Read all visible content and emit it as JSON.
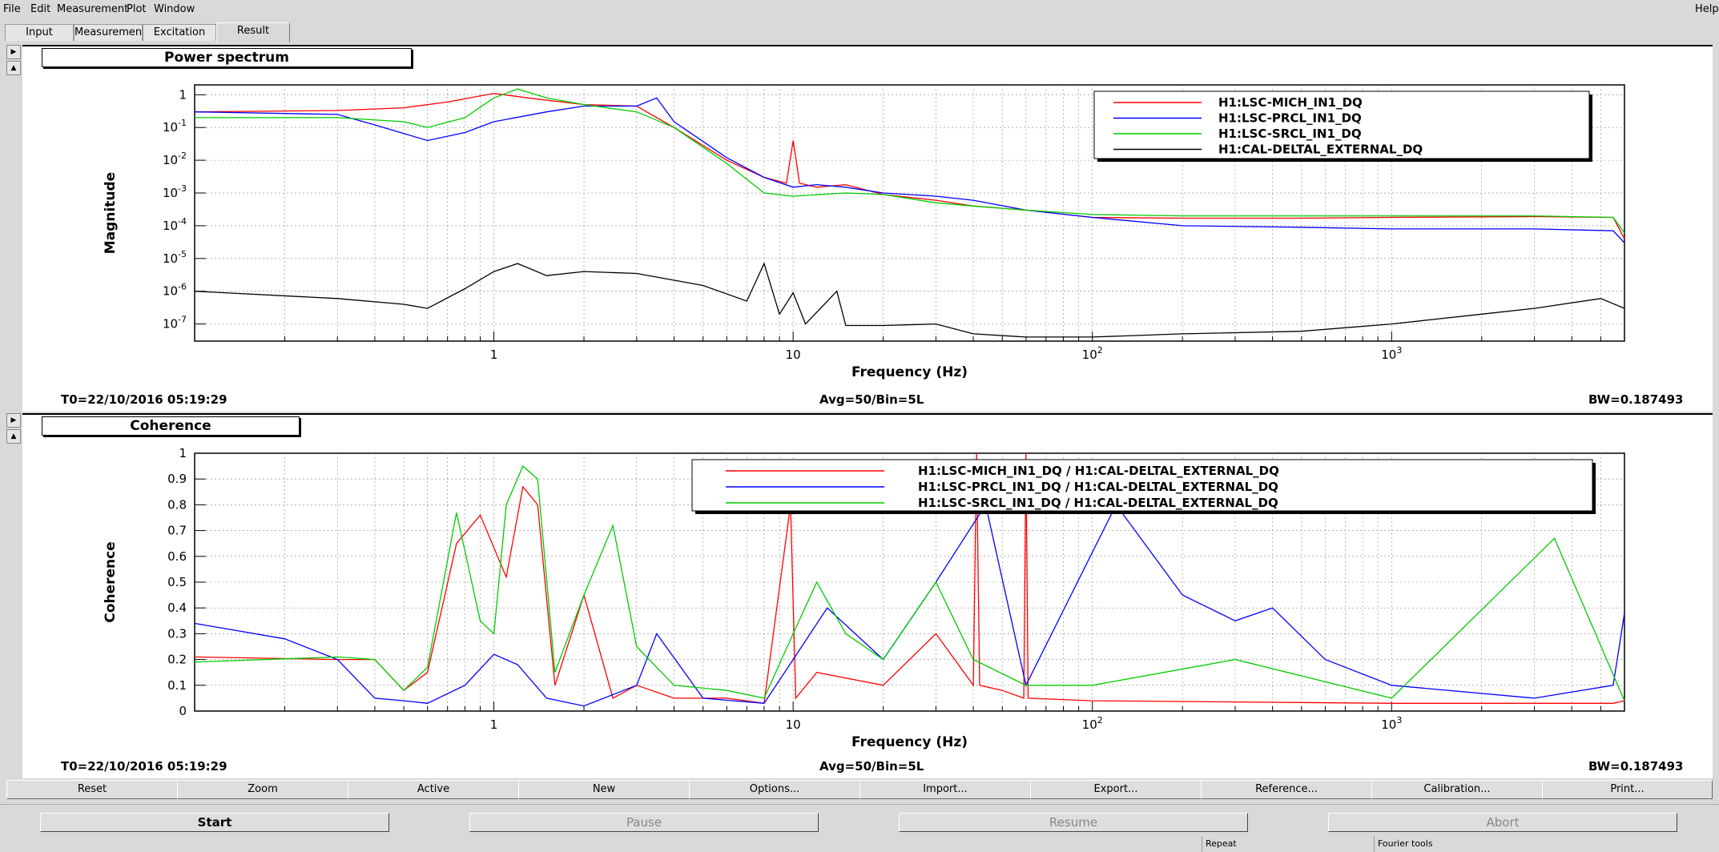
{
  "menubar": {
    "items": [
      "File",
      "Edit",
      "Measurement",
      "Plot",
      "Window"
    ],
    "help": "Help"
  },
  "tabs": [
    "Input",
    "Measurement",
    "Excitation",
    "Result"
  ],
  "active_tab": "Result",
  "colors": {
    "mich": "#ff0000",
    "prcl": "#0000ff",
    "srcl": "#00cc00",
    "darm": "#000000"
  },
  "power_panel": {
    "title": "Power spectrum",
    "ylabel": "Magnitude",
    "xlabel": "Frequency (Hz)",
    "t0": "T0=22/10/2016 05:19:29",
    "avg": "Avg=50/Bin=5L",
    "bw": "BW=0.187493",
    "legend": [
      "H1:LSC-MICH_IN1_DQ",
      "H1:LSC-PRCL_IN1_DQ",
      "H1:LSC-SRCL_IN1_DQ",
      "H1:CAL-DELTAL_EXTERNAL_DQ"
    ]
  },
  "coh_panel": {
    "title": "Coherence",
    "ylabel": "Coherence",
    "xlabel": "Frequency (Hz)",
    "t0": "T0=22/10/2016 05:19:29",
    "avg": "Avg=50/Bin=5L",
    "bw": "BW=0.187493",
    "legend": [
      "H1:LSC-MICH_IN1_DQ / H1:CAL-DELTAL_EXTERNAL_DQ",
      "H1:LSC-PRCL_IN1_DQ / H1:CAL-DELTAL_EXTERNAL_DQ",
      "H1:LSC-SRCL_IN1_DQ / H1:CAL-DELTAL_EXTERNAL_DQ"
    ]
  },
  "chart_data": [
    {
      "type": "line",
      "title": "Power spectrum",
      "xlabel": "Frequency (Hz)",
      "ylabel": "Magnitude",
      "xscale": "log",
      "yscale": "log",
      "xlim": [
        0.1,
        6000
      ],
      "ylim": [
        3e-08,
        2
      ],
      "x_ticks": [
        "1",
        "10",
        "10^2",
        "10^3"
      ],
      "y_ticks": [
        "1",
        "10^-1",
        "10^-2",
        "10^-3",
        "10^-4",
        "10^-5",
        "10^-6",
        "10^-7"
      ],
      "grid": true,
      "legend_position": "top-right",
      "series": [
        {
          "name": "H1:LSC-MICH_IN1_DQ",
          "x": [
            0.1,
            0.3,
            0.5,
            0.7,
            1.0,
            1.3,
            2.0,
            3.0,
            4.0,
            6.0,
            8.0,
            9.5,
            10.0,
            10.5,
            12,
            15,
            20,
            30,
            40,
            60,
            100,
            200,
            500,
            1000,
            3000,
            5500,
            6000
          ],
          "y": [
            0.3,
            0.33,
            0.4,
            0.6,
            1.1,
            0.8,
            0.5,
            0.45,
            0.1,
            0.01,
            0.003,
            0.002,
            0.04,
            0.002,
            0.0015,
            0.0018,
            0.0009,
            0.0006,
            0.0004,
            0.0003,
            0.00018,
            0.00017,
            0.00017,
            0.00018,
            0.00019,
            0.00018,
            4e-05
          ]
        },
        {
          "name": "H1:LSC-PRCL_IN1_DQ",
          "x": [
            0.1,
            0.3,
            0.4,
            0.6,
            0.8,
            1.0,
            1.5,
            2.0,
            3.0,
            3.5,
            4.0,
            6.0,
            8.0,
            10,
            12,
            15,
            20,
            30,
            40,
            60,
            100,
            200,
            500,
            1000,
            3000,
            5500,
            6000
          ],
          "y": [
            0.3,
            0.25,
            0.12,
            0.04,
            0.07,
            0.15,
            0.3,
            0.45,
            0.45,
            0.8,
            0.15,
            0.012,
            0.003,
            0.0015,
            0.0018,
            0.0015,
            0.001,
            0.0008,
            0.0006,
            0.0003,
            0.00018,
            0.0001,
            9e-05,
            8e-05,
            8e-05,
            7e-05,
            3e-05
          ]
        },
        {
          "name": "H1:LSC-SRCL_IN1_DQ",
          "x": [
            0.1,
            0.3,
            0.5,
            0.6,
            0.8,
            1.0,
            1.2,
            1.5,
            2.0,
            3.0,
            4.0,
            6.0,
            8.0,
            10,
            15,
            20,
            30,
            40,
            60,
            100,
            200,
            500,
            1000,
            3000,
            5500,
            6000
          ],
          "y": [
            0.2,
            0.2,
            0.15,
            0.1,
            0.2,
            0.8,
            1.5,
            0.8,
            0.5,
            0.3,
            0.1,
            0.008,
            0.001,
            0.0008,
            0.001,
            0.0009,
            0.0005,
            0.0004,
            0.0003,
            0.00022,
            0.0002,
            0.0002,
            0.0002,
            0.0002,
            0.00018,
            6e-05
          ]
        },
        {
          "name": "H1:CAL-DELTAL_EXTERNAL_DQ",
          "x": [
            0.1,
            0.3,
            0.5,
            0.6,
            0.8,
            1.0,
            1.2,
            1.5,
            2.0,
            3.0,
            5.0,
            7.0,
            8.0,
            9.0,
            10,
            11,
            14,
            15,
            20,
            30,
            40,
            60,
            100,
            200,
            500,
            1000,
            2000,
            3000,
            5000,
            6000
          ],
          "y": [
            1e-06,
            6e-07,
            4e-07,
            3e-07,
            1.2e-06,
            4e-06,
            7e-06,
            3e-06,
            4e-06,
            3.5e-06,
            1.5e-06,
            5e-07,
            7e-06,
            2e-07,
            9e-07,
            1e-07,
            1e-06,
            9e-08,
            9e-08,
            1e-07,
            5e-08,
            4e-08,
            4e-08,
            5e-08,
            6e-08,
            1e-07,
            2e-07,
            3e-07,
            6e-07,
            3e-07
          ]
        }
      ]
    },
    {
      "type": "line",
      "title": "Coherence",
      "xlabel": "Frequency (Hz)",
      "ylabel": "Coherence",
      "xscale": "log",
      "xlim": [
        0.1,
        6000
      ],
      "ylim": [
        0,
        1
      ],
      "x_ticks": [
        "1",
        "10",
        "10^2",
        "10^3"
      ],
      "y_ticks": [
        "0",
        "0.1",
        "0.2",
        "0.3",
        "0.4",
        "0.5",
        "0.6",
        "0.7",
        "0.8",
        "0.9",
        "1"
      ],
      "grid": true,
      "legend_position": "top-right",
      "series": [
        {
          "name": "H1:LSC-MICH_IN1_DQ / H1:CAL-DELTAL_EXTERNAL_DQ",
          "x": [
            0.1,
            0.3,
            0.4,
            0.5,
            0.6,
            0.75,
            0.9,
            1.1,
            1.25,
            1.4,
            1.6,
            2.0,
            2.5,
            3.0,
            4.0,
            6.0,
            8.0,
            9.8,
            10.2,
            12,
            20,
            30,
            40,
            41,
            42,
            50,
            59,
            60,
            61,
            100,
            1000,
            5500,
            6000
          ],
          "y": [
            0.21,
            0.2,
            0.2,
            0.08,
            0.15,
            0.65,
            0.76,
            0.52,
            0.87,
            0.8,
            0.1,
            0.45,
            0.05,
            0.1,
            0.05,
            0.05,
            0.03,
            0.8,
            0.05,
            0.15,
            0.1,
            0.3,
            0.1,
            1.0,
            0.1,
            0.08,
            0.05,
            1.0,
            0.05,
            0.04,
            0.03,
            0.03,
            0.04
          ]
        },
        {
          "name": "H1:LSC-PRCL_IN1_DQ / H1:CAL-DELTAL_EXTERNAL_DQ",
          "x": [
            0.1,
            0.2,
            0.3,
            0.4,
            0.5,
            0.6,
            0.8,
            1.0,
            1.2,
            1.5,
            2.0,
            3.0,
            3.5,
            5.0,
            8.0,
            10,
            13,
            20,
            30,
            44,
            60,
            120,
            200,
            300,
            400,
            600,
            1000,
            3000,
            5500,
            6000
          ],
          "y": [
            0.34,
            0.28,
            0.2,
            0.05,
            0.04,
            0.03,
            0.1,
            0.22,
            0.18,
            0.05,
            0.02,
            0.1,
            0.3,
            0.05,
            0.03,
            0.2,
            0.4,
            0.2,
            0.5,
            0.8,
            0.1,
            0.8,
            0.45,
            0.35,
            0.4,
            0.2,
            0.1,
            0.05,
            0.1,
            0.38
          ]
        },
        {
          "name": "H1:LSC-SRCL_IN1_DQ / H1:CAL-DELTAL_EXTERNAL_DQ",
          "x": [
            0.1,
            0.3,
            0.4,
            0.5,
            0.6,
            0.75,
            0.9,
            1.0,
            1.1,
            1.25,
            1.4,
            1.6,
            2.0,
            2.5,
            3.0,
            4.0,
            6.0,
            8.0,
            10,
            12,
            15,
            20,
            30,
            40,
            60,
            100,
            300,
            1000,
            3500,
            6000
          ],
          "y": [
            0.19,
            0.21,
            0.2,
            0.08,
            0.17,
            0.77,
            0.35,
            0.3,
            0.8,
            0.95,
            0.9,
            0.15,
            0.45,
            0.72,
            0.25,
            0.1,
            0.08,
            0.05,
            0.3,
            0.5,
            0.3,
            0.2,
            0.5,
            0.2,
            0.1,
            0.1,
            0.2,
            0.05,
            0.67,
            0.04
          ]
        }
      ]
    }
  ],
  "action_buttons": [
    "Reset",
    "Zoom",
    "Active",
    "New",
    "Options...",
    "Import...",
    "Export...",
    "Reference...",
    "Calibration...",
    "Print..."
  ],
  "control_buttons": [
    "Start",
    "Pause",
    "Resume",
    "Abort"
  ],
  "statusbar": {
    "repeat": "Repeat",
    "fourier": "Fourier tools"
  }
}
